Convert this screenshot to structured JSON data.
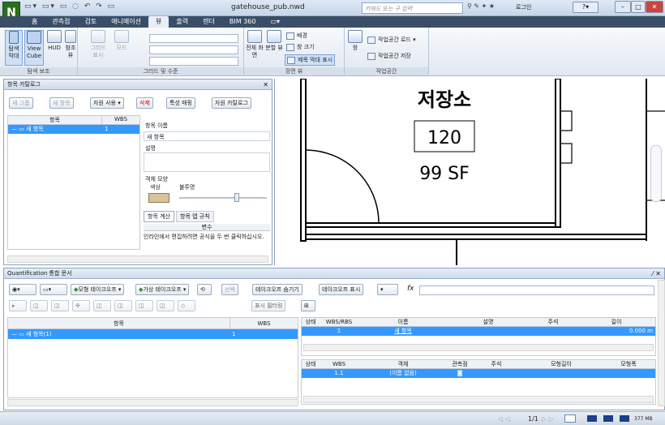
{
  "app": {
    "logo_letter": "N",
    "doc_title": "gatehouse_pub.nwd",
    "search_placeholder": "키워드 또는 구 입력",
    "login_label": "로그인",
    "qat_glyphs": "▭▾ ▭▾ ▭ ◌ ↶ ↷ ▭",
    "title_icons": "⚲ ✎ ✦ ★"
  },
  "window_buttons": [
    "–",
    "□",
    "✕"
  ],
  "tabs": [
    "홈",
    "관측점",
    "검토",
    "애니메이션",
    "뷰",
    "출력",
    "렌더",
    "BIM 360",
    "▭▾"
  ],
  "active_tab": "뷰",
  "ribbon": {
    "nav_aids": {
      "label": "탐색 보조",
      "buttons": [
        "탐색 막대",
        "View Cube",
        "HUD",
        "참조 뷰"
      ]
    },
    "grid_level": {
      "label": "그리드 및 수준",
      "buttons": [
        "그리드 표시",
        "모드"
      ]
    },
    "scene_view": {
      "label": "장면 뷰",
      "buttons": [
        "전체 화면",
        "분할 뷰"
      ],
      "small": [
        "배경",
        "창 크기",
        "제목 막대 표시"
      ]
    },
    "workspace": {
      "label": "작업공간",
      "buttons": [
        "창"
      ],
      "small": [
        "작업공간 로드 ▾",
        "작업공간 저장"
      ]
    }
  },
  "catalog": {
    "title": "항목 카탈로그",
    "toolbar": [
      "새 그룹",
      "새 항목",
      "자원 사용 ▾",
      "삭제",
      "특성 매핑",
      "자원 카탈로그"
    ],
    "columns": [
      "항목",
      "WBS"
    ],
    "rows": [
      {
        "name": "새 항목",
        "wbs": "1"
      }
    ],
    "props": {
      "name_label": "항목 이름",
      "name_value": "새 항목",
      "desc_label": "설명",
      "appearance_label": "객체 모양",
      "color_label": "색상",
      "transparency_label": "불투명",
      "color_value": "#d8c49a",
      "subtabs": [
        "항목 계산",
        "항목 맵 규칙"
      ],
      "calc_header": "변수",
      "calc_hint": "인라인에서 편집하려면 공식을 두 번 클릭하십시오."
    }
  },
  "viewport": {
    "room_name": "저장소",
    "room_number": "120",
    "room_area": "99 SF"
  },
  "quant": {
    "title": "Quantification 통합 문서",
    "toolbar": [
      "모형 테이크오프 ▾",
      "가상 테이크오프 ▾",
      "선택",
      "테이크오프 숨기기",
      "테이크오프 표시",
      "▾"
    ],
    "filter_label": "표시 필터링",
    "formula_symbol": "fx",
    "left_columns": [
      "항목",
      "WBS"
    ],
    "left_rows": [
      {
        "name": "새 항목(1)",
        "wbs": "1"
      }
    ],
    "top_columns": [
      "상태",
      "WBS/RBS",
      "이름",
      "설명",
      "주석",
      "길이"
    ],
    "top_rows": [
      {
        "status": "",
        "wbs": "1",
        "name": "새 항목",
        "desc": "",
        "note": "",
        "length": "0.000 m"
      }
    ],
    "bottom_columns": [
      "상태",
      "WBS",
      "객체",
      "관측점",
      "주석",
      "모형길이",
      "모형폭"
    ],
    "bottom_rows": [
      {
        "status": "",
        "wbs": "1.1",
        "object": "(이름 없음)",
        "viewpoint": "◙",
        "note": "",
        "mlen": "",
        "mwid": ""
      }
    ]
  },
  "status": {
    "page": "1/1",
    "memory": "377 MB"
  }
}
